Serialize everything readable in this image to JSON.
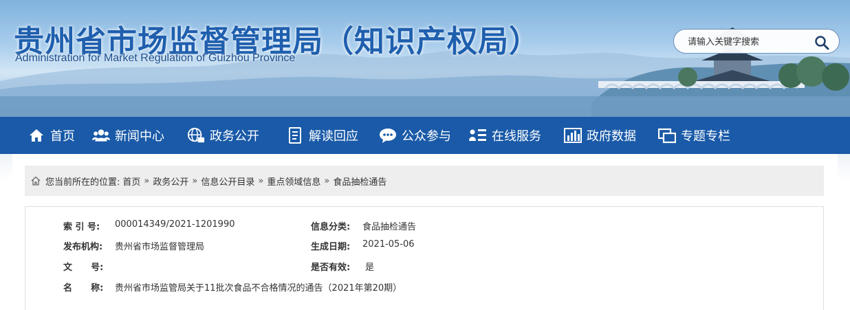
{
  "header": {
    "title": "贵州省市场监督管理局（知识产权局）",
    "subtitle": "Administration for Market Regulation of Guizhou Province",
    "search_placeholder": "请输入关键字搜索"
  },
  "nav": {
    "items": [
      {
        "label": "首页",
        "icon": "home-icon"
      },
      {
        "label": "新闻中心",
        "icon": "people-icon"
      },
      {
        "label": "政务公开",
        "icon": "globe-icon"
      },
      {
        "label": "解读回应",
        "icon": "document-icon"
      },
      {
        "label": "公众参与",
        "icon": "chat-icon"
      },
      {
        "label": "在线服务",
        "icon": "service-list-icon"
      },
      {
        "label": "政府数据",
        "icon": "bar-chart-icon"
      },
      {
        "label": "专题专栏",
        "icon": "windows-icon"
      }
    ]
  },
  "breadcrumb": {
    "prefix": "您当前所在的位置:",
    "items": [
      "首页",
      "政务公开",
      "信息公开目录",
      "重点领域信息",
      "食品抽检通告"
    ],
    "separator": "»"
  },
  "meta": {
    "index_label": "索 引 号:",
    "index_value": "000014349/2021-1201990",
    "category_label": "信息分类:",
    "category_value": "食品抽检通告",
    "publisher_label": "发布机构:",
    "publisher_value": "贵州省市场监督管理局",
    "date_label": "生成日期:",
    "date_value": "2021-05-06",
    "doc_no_label": "文      号:",
    "doc_no_value": "",
    "valid_label": "是否有效:",
    "valid_value": "是",
    "name_label": "名      称:",
    "name_value": "贵州省市场监管局关于11批次食品不合格情况的通告（2021年第20期）"
  },
  "colors": {
    "nav_bg": "#1a5aa8",
    "title": "#1f5fae",
    "breadcrumb_bg": "#eeeeee"
  }
}
